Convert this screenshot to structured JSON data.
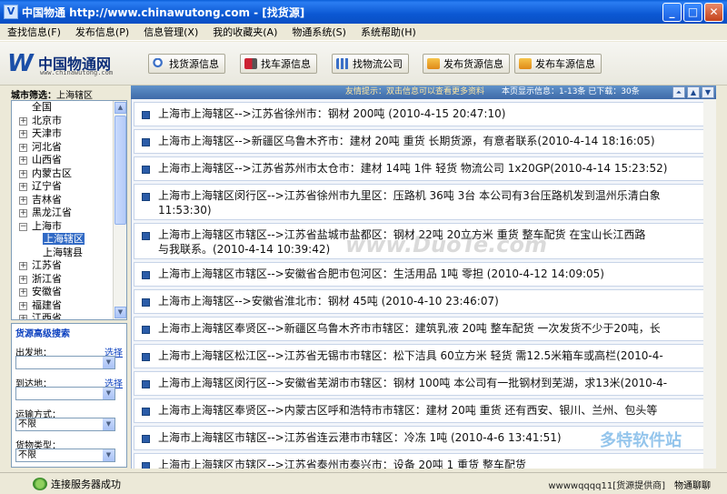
{
  "window": {
    "title": "中国物通 http://www.chinawutong.com - [找货源]",
    "controls": [
      "minimize",
      "maximize",
      "close"
    ]
  },
  "menu": [
    "查找信息(F)",
    "发布信息(P)",
    "信息管理(X)",
    "我的收藏夹(A)",
    "物通系统(S)",
    "系统帮助(H)"
  ],
  "logo": {
    "name": "中国物通网",
    "url": "www.chinawutong.com"
  },
  "toolbar": [
    {
      "label": "找货源信息",
      "icon": "search-icon"
    },
    {
      "label": "找车源信息",
      "icon": "truck-icon"
    },
    {
      "label": "找物流公司",
      "icon": "chart-icon"
    },
    {
      "label": "发布货源信息",
      "icon": "publish-icon"
    },
    {
      "label": "发布车源信息",
      "icon": "publish-icon"
    }
  ],
  "city_filter": {
    "label": "城市筛选：",
    "value": "上海辖区"
  },
  "tree": [
    {
      "label": "全国",
      "level": 0,
      "expander": ""
    },
    {
      "label": "北京市",
      "level": 0,
      "expander": "+"
    },
    {
      "label": "天津市",
      "level": 0,
      "expander": "+"
    },
    {
      "label": "河北省",
      "level": 0,
      "expander": "+"
    },
    {
      "label": "山西省",
      "level": 0,
      "expander": "+"
    },
    {
      "label": "内蒙古区",
      "level": 0,
      "expander": "+"
    },
    {
      "label": "辽宁省",
      "level": 0,
      "expander": "+"
    },
    {
      "label": "吉林省",
      "level": 0,
      "expander": "+"
    },
    {
      "label": "黑龙江省",
      "level": 0,
      "expander": "+"
    },
    {
      "label": "上海市",
      "level": 0,
      "expander": "−"
    },
    {
      "label": "上海辖区",
      "level": 1,
      "expander": "",
      "selected": true
    },
    {
      "label": "上海辖县",
      "level": 1,
      "expander": ""
    },
    {
      "label": "江苏省",
      "level": 0,
      "expander": "+"
    },
    {
      "label": "浙江省",
      "level": 0,
      "expander": "+"
    },
    {
      "label": "安徽省",
      "level": 0,
      "expander": "+"
    },
    {
      "label": "福建省",
      "level": 0,
      "expander": "+"
    },
    {
      "label": "江西省",
      "level": 0,
      "expander": "+"
    }
  ],
  "search_panel": {
    "title": "货源高级搜索",
    "from_label": "出发地：",
    "from_link": "选择",
    "to_label": "到达地：",
    "to_link": "选择",
    "transport_label": "运输方式：",
    "transport_value": "不限",
    "cargo_label": "货物类型：",
    "cargo_value": "不限"
  },
  "hint_bar": {
    "hint": "友情提示：双击信息可以查看更多资料",
    "page_info": "本页显示信息：1-13条 已下载：30条"
  },
  "rows": [
    {
      "line1": "上海市上海辖区-->江苏省徐州市：钢材 200吨 (2010-4-15 20:47:10)"
    },
    {
      "line1": "上海市上海辖区-->新疆区乌鲁木齐市：建材 20吨 重货 长期货源，有意者联系(2010-4-14 18:16:05)"
    },
    {
      "line1": "上海市上海辖区-->江苏省苏州市太仓市：建材 14吨 1件 轻货 物流公司 1x20GP(2010-4-14 15:23:52)"
    },
    {
      "line1": "上海市上海辖区闵行区-->江苏省徐州市九里区：压路机 36吨 3台 本公司有3台压路机发到温州乐清白象",
      "line2": "11:53:30)"
    },
    {
      "line1": "上海市上海辖区市辖区-->江苏省盐城市盐都区：钢材 22吨 20立方米 重货 整车配货 在宝山长江西路",
      "line2": "与我联系。(2010-4-14 10:39:42)"
    },
    {
      "line1": "上海市上海辖区市辖区-->安徽省合肥市包河区：生活用品 1吨 零担 (2010-4-12 14:09:05)"
    },
    {
      "line1": "上海市上海辖区-->安徽省淮北市：钢材 45吨 (2010-4-10 23:46:07)"
    },
    {
      "line1": "上海市上海辖区奉贤区-->新疆区乌鲁木齐市市辖区：建筑乳液 20吨 整车配货 一次发货不少于20吨，长"
    },
    {
      "line1": "上海市上海辖区松江区-->江苏省无锡市市辖区：松下洁具 60立方米 轻货 需12.5米箱车或高栏(2010-4-"
    },
    {
      "line1": "上海市上海辖区闵行区-->安徽省芜湖市市辖区：钢材 100吨 本公司有一批钢材到芜湖，求13米(2010-4-"
    },
    {
      "line1": "上海市上海辖区奉贤区-->内蒙古区呼和浩特市市辖区：建材 20吨 重货 还有西安、银川、兰州、包头等"
    },
    {
      "line1": "上海市上海辖区市辖区-->江苏省连云港市市辖区：冷冻 1吨 (2010-4-6 13:41:51)"
    },
    {
      "line1": "上海市上海辖区市辖区-->江苏省泰州市泰兴市：设备 20吨 1 重货 整车配货"
    }
  ],
  "watermark": "www.DuoTe.com",
  "watermark2": "多特软件站",
  "status": {
    "connection": "连接服务器成功",
    "user": "wwwwqqqq11[货源提供商]",
    "chat": "物通聊聊"
  }
}
